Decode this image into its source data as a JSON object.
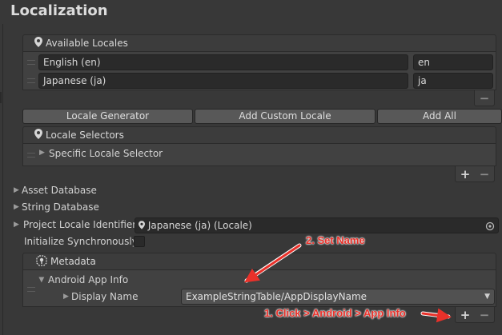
{
  "header": {
    "title": "Localization"
  },
  "available_locales": {
    "header": "Available Locales",
    "rows": [
      {
        "name": "English (en)",
        "code": "en"
      },
      {
        "name": "Japanese (ja)",
        "code": "ja"
      }
    ],
    "minus": "−"
  },
  "buttons": {
    "locale_generator": "Locale Generator",
    "add_custom_locale": "Add Custom Locale",
    "add_all": "Add All"
  },
  "locale_selectors": {
    "header": "Locale Selectors",
    "item": "Specific Locale Selector",
    "plus": "+",
    "minus": "−"
  },
  "foldouts": {
    "asset_database": "Asset Database",
    "string_database": "String Database"
  },
  "project_locale": {
    "label": "Project Locale Identifier",
    "value": "Japanese (ja) (Locale)"
  },
  "initialize": {
    "label": "Initialize Synchronously",
    "checked": false
  },
  "metadata": {
    "header": "Metadata",
    "android_app_info": "Android App Info",
    "display_name_label": "Display Name",
    "display_name_value": "ExampleStringTable/AppDisplayName",
    "plus": "+",
    "minus": "−"
  },
  "annotations": {
    "set_name": "2. Set Name",
    "click_android": "1. Click > Android > App Info",
    "color": "#e8312a"
  },
  "icons": [
    "location-pin-icon",
    "metadata-icon",
    "object-picker-icon",
    "dropdown-arrow-icon",
    "foldout-triangle-icon"
  ]
}
